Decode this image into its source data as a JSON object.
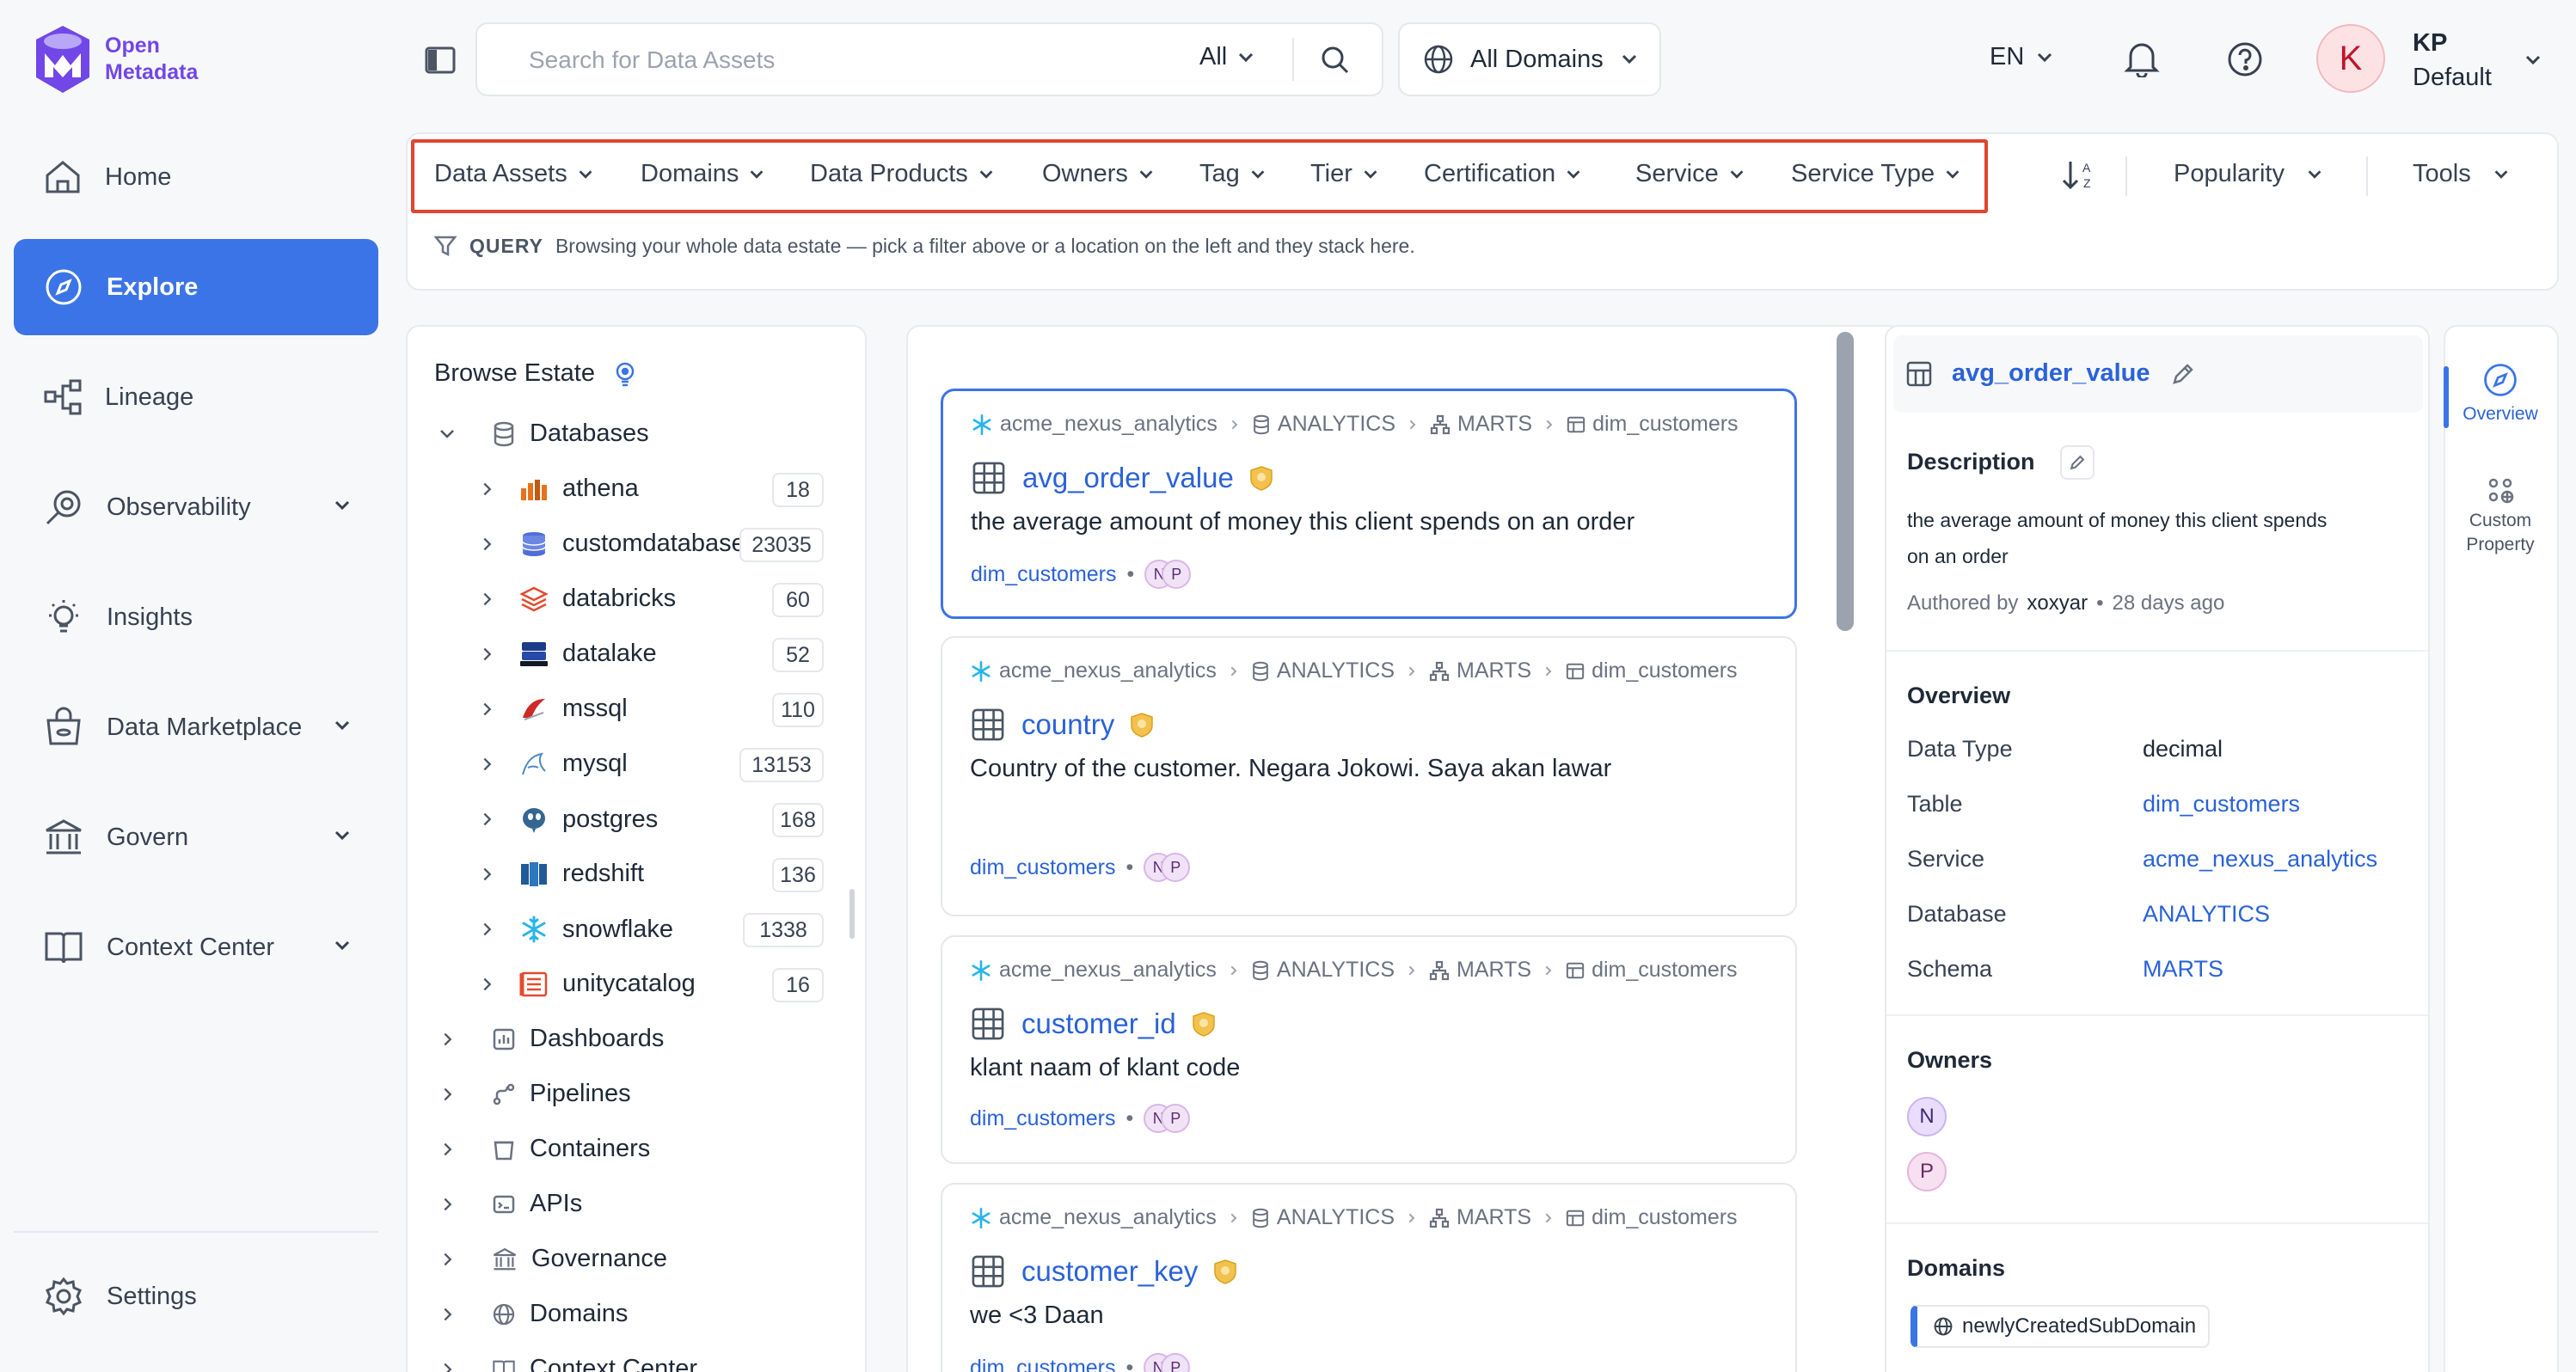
{
  "app": {
    "logo_line1": "Open",
    "logo_line2": "Metadata"
  },
  "sidebar": {
    "items": [
      {
        "label": "Home",
        "icon": "home-icon"
      },
      {
        "label": "Explore",
        "icon": "compass-icon",
        "active": true
      },
      {
        "label": "Lineage",
        "icon": "lineage-icon"
      },
      {
        "label": "Observability",
        "icon": "observability-icon",
        "expandable": true
      },
      {
        "label": "Insights",
        "icon": "bulb-icon"
      },
      {
        "label": "Data Marketplace",
        "icon": "marketplace-icon",
        "expandable": true
      },
      {
        "label": "Govern",
        "icon": "bank-icon",
        "expandable": true
      },
      {
        "label": "Context Center",
        "icon": "book-icon",
        "expandable": true
      }
    ],
    "settings_label": "Settings"
  },
  "topbar": {
    "search_placeholder": "Search for Data Assets",
    "search_scope": "All",
    "domain_selector": "All Domains",
    "language": "EN",
    "user_initial": "K",
    "user_name": "KP",
    "user_role": "Default"
  },
  "filters": {
    "items": [
      "Data Assets",
      "Domains",
      "Data Products",
      "Owners",
      "Tag",
      "Tier",
      "Certification",
      "Service",
      "Service Type"
    ],
    "sort_label": "Popularity",
    "tools_label": "Tools",
    "query_label": "QUERY",
    "query_hint": "Browsing your whole data estate — pick a filter above or a location on the left and they stack here."
  },
  "browse": {
    "title": "Browse Estate",
    "root": "Databases",
    "databases": [
      {
        "name": "athena",
        "count": "18"
      },
      {
        "name": "customdatabase",
        "count": "23035"
      },
      {
        "name": "databricks",
        "count": "60"
      },
      {
        "name": "datalake",
        "count": "52"
      },
      {
        "name": "mssql",
        "count": "110"
      },
      {
        "name": "mysql",
        "count": "13153"
      },
      {
        "name": "postgres",
        "count": "168"
      },
      {
        "name": "redshift",
        "count": "136"
      },
      {
        "name": "snowflake",
        "count": "1338"
      },
      {
        "name": "unitycatalog",
        "count": "16"
      }
    ],
    "other_groups": [
      "Dashboards",
      "Pipelines",
      "Containers",
      "APIs",
      "Governance",
      "Domains",
      "Context Center"
    ]
  },
  "results": [
    {
      "crumbs": [
        "acme_nexus_analytics",
        "ANALYTICS",
        "MARTS",
        "dim_customers"
      ],
      "name": "avg_order_value",
      "description": "the average amount of money this client spends on an order",
      "table": "dim_customers",
      "owners": [
        "N",
        "P"
      ]
    },
    {
      "crumbs": [
        "acme_nexus_analytics",
        "ANALYTICS",
        "MARTS",
        "dim_customers"
      ],
      "name": "country",
      "description": "Country of the customer. Negara Jokowi. Saya akan lawar",
      "table": "dim_customers",
      "owners": [
        "N",
        "P"
      ]
    },
    {
      "crumbs": [
        "acme_nexus_analytics",
        "ANALYTICS",
        "MARTS",
        "dim_customers"
      ],
      "name": "customer_id",
      "description": "klant naam of klant code",
      "table": "dim_customers",
      "owners": [
        "N",
        "P"
      ]
    },
    {
      "crumbs": [
        "acme_nexus_analytics",
        "ANALYTICS",
        "MARTS",
        "dim_customers"
      ],
      "name": "customer_key",
      "description": "we <3 Daan",
      "table": "dim_customers",
      "owners": [
        "N",
        "P"
      ]
    }
  ],
  "detail": {
    "name": "avg_order_value",
    "description_title": "Description",
    "description_line1": "the average amount of money this client spends",
    "description_line2": "on an order",
    "authored_prefix": "Authored by",
    "author": "xoxyar",
    "authored_when": "28 days ago",
    "overview_title": "Overview",
    "overview": [
      {
        "label": "Data Type",
        "value": "decimal",
        "link": false
      },
      {
        "label": "Table",
        "value": "dim_customers",
        "link": true
      },
      {
        "label": "Service",
        "value": "acme_nexus_analytics",
        "link": true
      },
      {
        "label": "Database",
        "value": "ANALYTICS",
        "link": true
      },
      {
        "label": "Schema",
        "value": "MARTS",
        "link": true
      }
    ],
    "owners_title": "Owners",
    "owners": [
      "N",
      "P"
    ],
    "domains_title": "Domains",
    "domain": "newlyCreatedSubDomain"
  },
  "right_tabs": [
    {
      "label": "Overview",
      "active": true
    },
    {
      "label_line1": "Custom",
      "label_line2": "Property"
    }
  ],
  "colors": {
    "accent": "#3b74e6",
    "link": "#2a62d8",
    "highlight": "#e0452e",
    "brand": "#7147e8"
  }
}
